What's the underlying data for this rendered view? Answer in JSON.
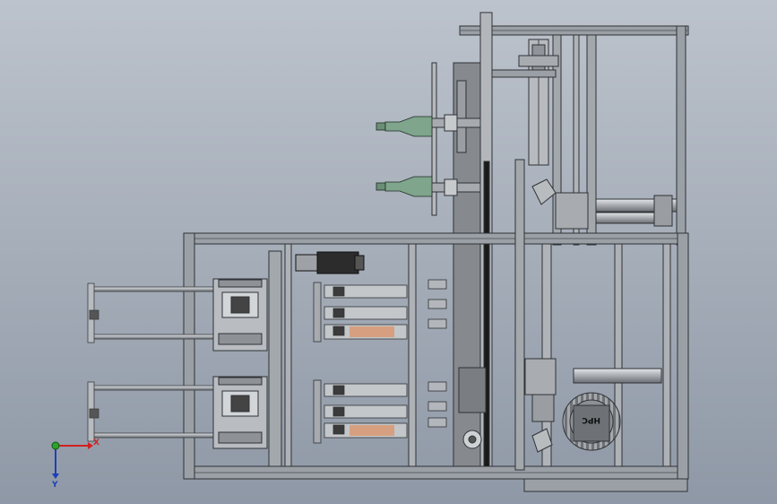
{
  "viewport": {
    "background_top": "#bcc3cc",
    "background_bottom": "#8f98a6",
    "frame_color": "#9aa0a6",
    "frame_edge": "#2f3236",
    "bottle_color": "#7fa58c",
    "motor_color": "#2c2c2c"
  },
  "logo": {
    "text": "HPC"
  },
  "axes_triad": {
    "x_label": "X",
    "y_label": "Y",
    "x_color": "#d22020",
    "y_color": "#1c3fb8",
    "z_color": "#2aa42a"
  }
}
